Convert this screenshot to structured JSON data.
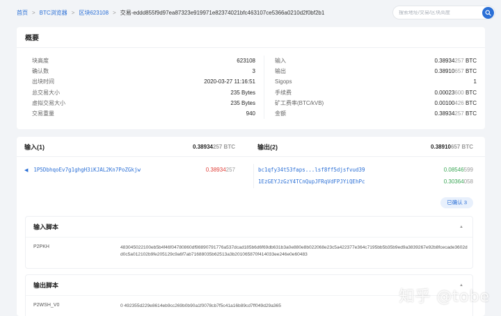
{
  "breadcrumb": {
    "home": "首页",
    "explorer": "BTC浏览器",
    "block": "区块623108",
    "current": "交易-eddd855f9d97ea87323e919971e82374021bfc463107ce5366a0210d2f0bf2b1"
  },
  "search": {
    "placeholder": "搜索地址/交易/区块高度"
  },
  "overview": {
    "title": "概要",
    "left": [
      {
        "label": "块高度",
        "value": "623108"
      },
      {
        "label": "确认数",
        "value": "3"
      },
      {
        "label": "出块时间",
        "value": "2020-03-27 11:16:51"
      },
      {
        "label": "总交易大小",
        "value": "235 Bytes"
      },
      {
        "label": "虚拟交易大小",
        "value": "235 Bytes"
      },
      {
        "label": "交易重量",
        "value": "940"
      }
    ],
    "right": [
      {
        "label": "输入",
        "main": "0.38934",
        "dim": "257",
        "unit": " BTC"
      },
      {
        "label": "输出",
        "main": "0.38910",
        "dim": "657",
        "unit": " BTC"
      },
      {
        "label": "Sigops",
        "main": "1",
        "dim": "",
        "unit": ""
      },
      {
        "label": "手续费",
        "main": "0.00023",
        "dim": "600",
        "unit": " BTC"
      },
      {
        "label": "矿工费率(BTC/kVB)",
        "main": "0.00100",
        "dim": "426",
        "unit": " BTC"
      },
      {
        "label": "金额",
        "main": "0.38934",
        "dim": "257",
        "unit": " BTC"
      }
    ]
  },
  "inputs": {
    "title": "输入(1)",
    "total_main": "0.38934",
    "total_dim": "257",
    "unit": " BTC",
    "items": [
      {
        "address": "1P5DbhqoEv7g1ghgH3iKJAL2Kn7PoZGkjw",
        "main": "0.38934",
        "dim": "257"
      }
    ]
  },
  "outputs": {
    "title": "输出(2)",
    "total_main": "0.38910",
    "total_dim": "657",
    "unit": " BTC",
    "items": [
      {
        "address": "bc1qfy34t53faps...lsf8ff5djsfvud39",
        "main": "0.08546",
        "dim": "599"
      },
      {
        "address": "1EzGEYJzGzY4TCnQupJFRqVdFPJYiQEhPc",
        "main": "0.30364",
        "dim": "058"
      }
    ]
  },
  "confirmed_badge": "已确认 3",
  "input_script": {
    "title": "输入脚本",
    "type": "P2PKH",
    "hex": "483045022100eb5b4f46f04780860df98890791776a537dcad185b6d6f69db631b3a0e880e8b022068e23c5a422377e364c7195bb5b35b9ed9a3839267e92b8fcecade3602dd0c5a012102b9fe205129c9a6f7ab71688035b62513a3b201065870f414033ee246e0e60483"
  },
  "output_script": {
    "title": "输出脚本",
    "type": "P2WSH_V0",
    "hex": "0 492355d229e8614eb9cc269b0b90a1f0078cb7f5c41a16b89cd7ff049d29a365"
  },
  "watermark": "知乎 @tobe"
}
